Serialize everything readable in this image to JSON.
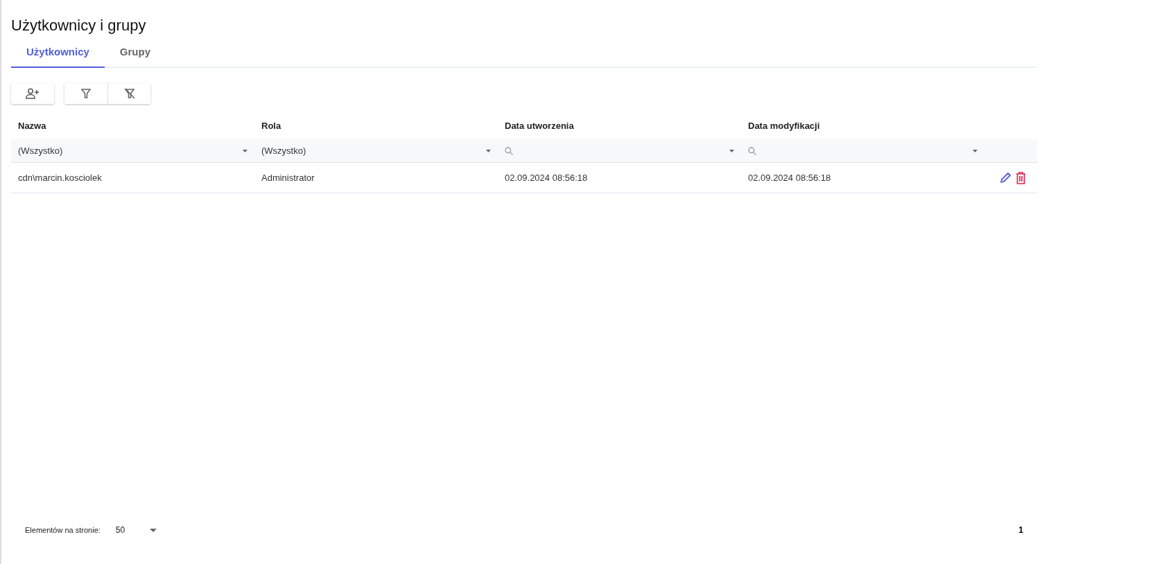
{
  "title": "Użytkownicy i grupy",
  "tabs": [
    {
      "label": "Użytkownicy",
      "selected": true
    },
    {
      "label": "Grupy",
      "selected": false
    }
  ],
  "table": {
    "columns": [
      "Nazwa",
      "Rola",
      "Data utworzenia",
      "Data modyfikacji"
    ],
    "filters": [
      {
        "kind": "select",
        "value": "(Wszystko)"
      },
      {
        "kind": "select",
        "value": "(Wszystko)"
      },
      {
        "kind": "search"
      },
      {
        "kind": "search"
      }
    ],
    "rows": [
      {
        "cells": [
          "cdn\\marcin.kosciolek",
          "Administrator",
          "02.09.2024 08:56:18",
          "02.09.2024 08:56:18"
        ]
      }
    ]
  },
  "pager": {
    "label": "Elementów na stronie:",
    "page_size": "50",
    "page": "1"
  }
}
